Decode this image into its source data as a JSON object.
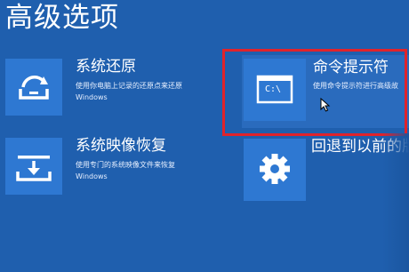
{
  "page": {
    "title": "高级选项"
  },
  "tiles": {
    "system_restore": {
      "title": "系统还原",
      "desc_line1": "使用你电脑上记录的还原点来还原",
      "desc_line2": "Windows",
      "icon": "restore-icon"
    },
    "system_image_recovery": {
      "title": "系统映像恢复",
      "desc_line1": "使用专门的系统映像文件来恢复",
      "desc_line2": "Windows",
      "icon": "image-recovery-icon"
    },
    "command_prompt": {
      "title": "命令提示符",
      "desc_line1": "使用命令提示符进行高级故",
      "icon_text": "C:\\",
      "icon": "command-prompt-icon"
    },
    "go_back": {
      "title": "回退到以前的版",
      "icon": "gear-icon"
    }
  },
  "colors": {
    "background": "#1f5fae",
    "tile": "#2e78d2",
    "highlight_frame": "#e0232b"
  }
}
